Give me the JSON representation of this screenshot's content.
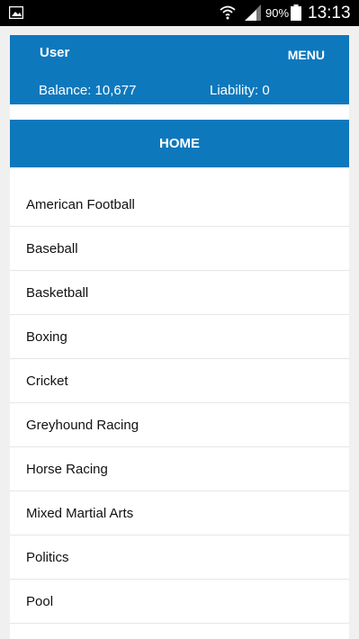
{
  "status_bar": {
    "battery_percent": "90%",
    "time": "13:13",
    "icons": [
      "gallery-icon",
      "wifi-icon",
      "signal-icon",
      "battery-icon"
    ]
  },
  "header": {
    "user_label": "User",
    "menu_label": "MENU",
    "balance_text": "Balance: 10,677",
    "liability_text": "Liability: 0"
  },
  "home": {
    "label": "HOME"
  },
  "sports": {
    "items": [
      "American Football",
      "Baseball",
      "Basketball",
      "Boxing",
      "Cricket",
      "Greyhound Racing",
      "Horse Racing",
      "Mixed Martial Arts",
      "Politics",
      "Pool"
    ]
  },
  "colors": {
    "accent": "#0e78bd",
    "background": "#f0f0f0",
    "statusbar": "#000000"
  }
}
